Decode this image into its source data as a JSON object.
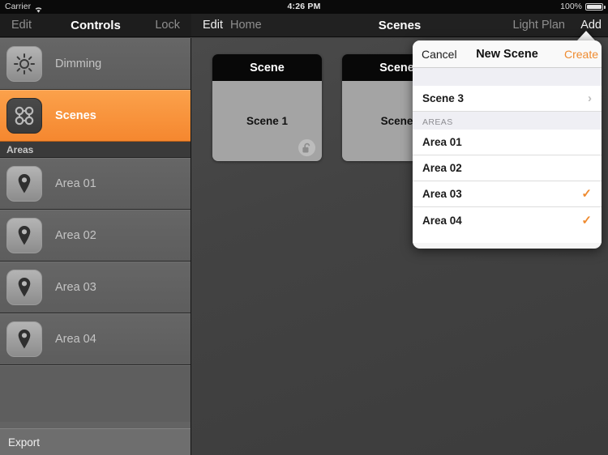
{
  "status_bar": {
    "carrier": "Carrier",
    "wifi_icon": "wifi-icon",
    "time": "4:26 PM",
    "battery_percent": "100%",
    "battery_icon": "battery-full-icon"
  },
  "left_nav": {
    "edit_label": "Edit",
    "title": "Controls",
    "lock_label": "Lock"
  },
  "right_nav": {
    "edit_label": "Edit",
    "home_label": "Home",
    "title": "Scenes",
    "light_plan_label": "Light Plan",
    "add_label": "Add"
  },
  "sidebar": {
    "top_items": [
      {
        "label": "Dimming",
        "icon": "brightness-sun-icon",
        "selected": false
      },
      {
        "label": "Scenes",
        "icon": "scenes-grid-icon",
        "selected": true
      }
    ],
    "section_header": "Areas",
    "areas": [
      {
        "label": "Area 01",
        "icon": "map-pin-icon"
      },
      {
        "label": "Area 02",
        "icon": "map-pin-icon"
      },
      {
        "label": "Area 03",
        "icon": "map-pin-icon"
      },
      {
        "label": "Area 04",
        "icon": "map-pin-icon"
      }
    ],
    "export_label": "Export"
  },
  "content": {
    "cards": [
      {
        "header": "Scene",
        "name": "Scene 1",
        "lock_icon": "unlocked-padlock-icon"
      },
      {
        "header": "Scene",
        "name": "Scene",
        "lock_icon": "unlocked-padlock-icon"
      }
    ]
  },
  "popover": {
    "cancel_label": "Cancel",
    "title": "New Scene",
    "create_label": "Create",
    "scene_row": {
      "label": "Scene 3",
      "chevron": "›"
    },
    "section_label": "AREAS",
    "areas": [
      {
        "label": "Area 01",
        "checked": false,
        "check": ""
      },
      {
        "label": "Area 02",
        "checked": false,
        "check": ""
      },
      {
        "label": "Area 03",
        "checked": true,
        "check": "✓"
      },
      {
        "label": "Area 04",
        "checked": true,
        "check": "✓"
      }
    ]
  },
  "colors": {
    "accent_orange": "#f5872f",
    "popover_accent": "#ef8b30",
    "sidebar_gray": "#636363",
    "content_gray": "#434343"
  }
}
